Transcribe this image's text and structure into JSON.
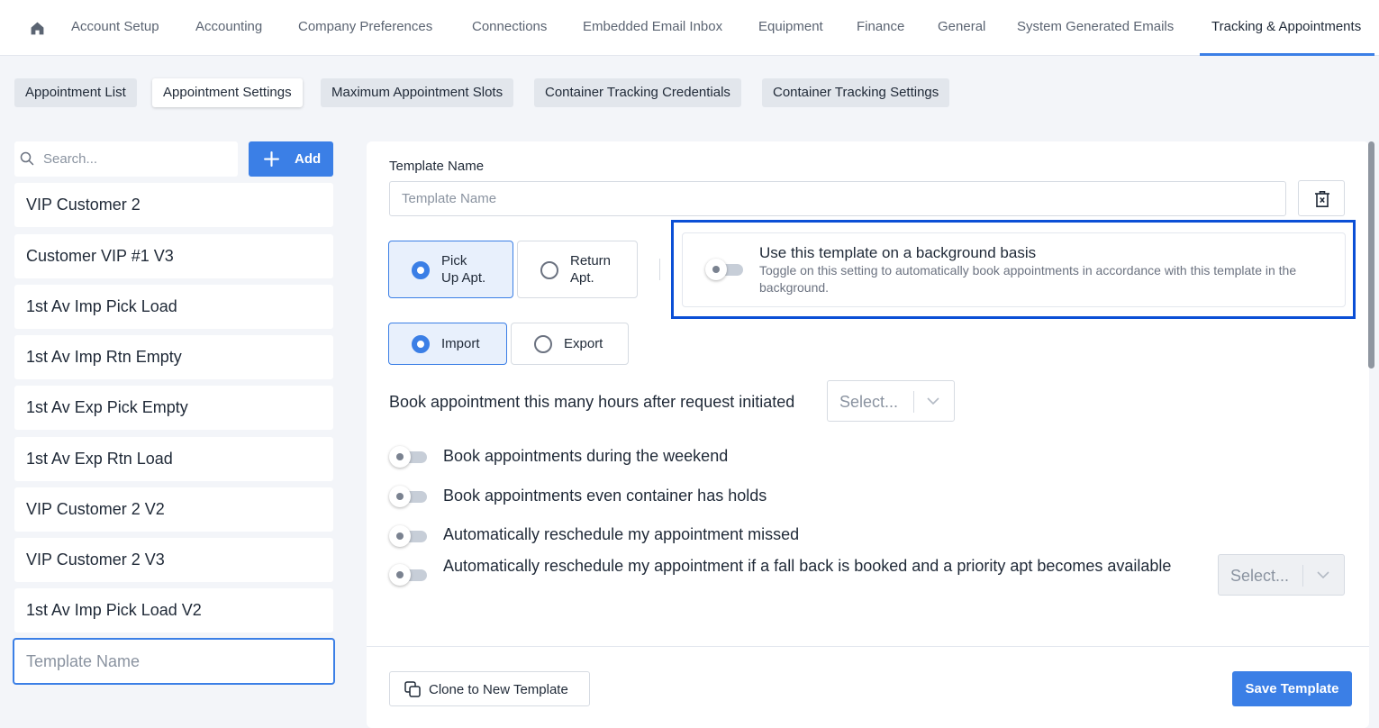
{
  "nav": {
    "tabs": [
      {
        "label": "Account Setup"
      },
      {
        "label": "Accounting"
      },
      {
        "label": "Company Preferences"
      },
      {
        "label": "Connections"
      },
      {
        "label": "Embedded Email Inbox"
      },
      {
        "label": "Equipment"
      },
      {
        "label": "Finance"
      },
      {
        "label": "General"
      },
      {
        "label": "System Generated Emails"
      },
      {
        "label": "Tracking & Appointments"
      }
    ],
    "active_tab": "Tracking & Appointments"
  },
  "subtabs": [
    {
      "label": "Appointment List"
    },
    {
      "label": "Appointment Settings"
    },
    {
      "label": "Maximum Appointment Slots"
    },
    {
      "label": "Container Tracking Credentials"
    },
    {
      "label": "Container Tracking Settings"
    }
  ],
  "sidebar": {
    "search_placeholder": "Search...",
    "add_label": "Add",
    "items": [
      {
        "label": "VIP Customer 2"
      },
      {
        "label": "Customer VIP #1 V3"
      },
      {
        "label": "1st Av Imp Pick Load"
      },
      {
        "label": "1st Av Imp Rtn Empty"
      },
      {
        "label": "1st Av Exp Pick Empty"
      },
      {
        "label": "1st Av Exp Rtn Load"
      },
      {
        "label": "VIP Customer 2 V2"
      },
      {
        "label": "VIP Customer 2 V3"
      },
      {
        "label": "1st Av Imp Pick Load V2"
      }
    ],
    "new_item_placeholder": "Template Name"
  },
  "form": {
    "template_name_label": "Template Name",
    "template_name_placeholder": "Template Name",
    "template_name_value": "",
    "apt_type": {
      "options": [
        {
          "line1": "Pick",
          "line2": "Up Apt.",
          "selected": true
        },
        {
          "line1": "Return",
          "line2": "Apt.",
          "selected": false
        }
      ]
    },
    "background": {
      "title": "Use this template on a background basis",
      "description": "Toggle on this setting to automatically book appointments in accordance with this template in the background.",
      "enabled": false
    },
    "direction": {
      "options": [
        {
          "label": "Import",
          "selected": true
        },
        {
          "label": "Export",
          "selected": false
        }
      ]
    },
    "hours": {
      "label": "Book appointment this many hours after request initiated",
      "placeholder": "Select..."
    },
    "options": [
      {
        "label": "Book appointments during the weekend",
        "enabled": false
      },
      {
        "label": "Book appointments even container has holds",
        "enabled": false
      },
      {
        "label": "Automatically reschedule my appointment missed",
        "enabled": false
      },
      {
        "label": "Automatically reschedule my appointment if a fall back is booked and a priority apt becomes available",
        "enabled": false
      }
    ],
    "fallback_select_placeholder": "Select..."
  },
  "footer": {
    "clone_label": "Clone to New Template",
    "save_label": "Save Template"
  },
  "colors": {
    "accent": "#3b7fe6",
    "highlight_border": "#0b4fd6",
    "selected_bg": "#e8f0fc"
  }
}
